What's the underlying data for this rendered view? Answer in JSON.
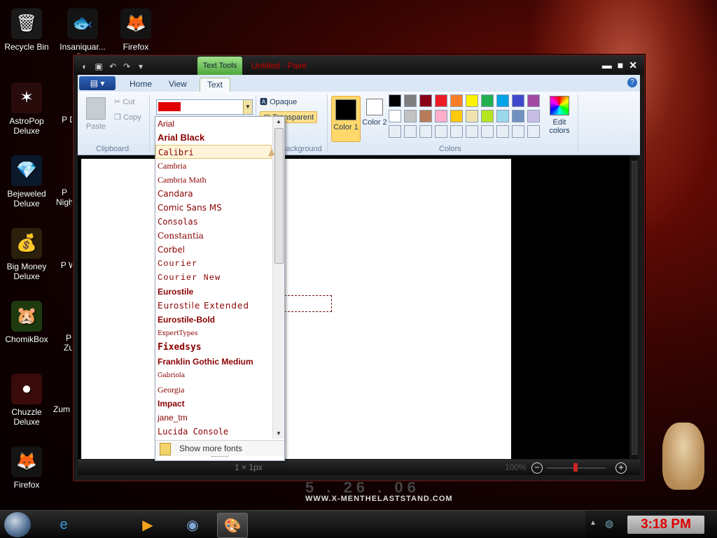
{
  "desktop": {
    "icons": [
      {
        "label": "Recycle Bin",
        "glyph": "🗑",
        "bg": "#1a1a1a"
      },
      {
        "label": "Insaniquar... Del",
        "glyph": "🐟",
        "bg": "#141414"
      },
      {
        "label": "Firefox",
        "glyph": "🦊",
        "bg": "#141414"
      },
      {
        "label": "AstroPop Deluxe",
        "glyph": "✶",
        "bg": "#2a0b0b"
      },
      {
        "label": "Bejeweled Deluxe",
        "glyph": "💎",
        "bg": "#0b1a2a"
      },
      {
        "label": "Big Money Deluxe",
        "glyph": "💰",
        "bg": "#2a200b"
      },
      {
        "label": "ChomikBox",
        "glyph": "🐹",
        "bg": "#1e3a0f"
      },
      {
        "label": "Chuzzle Deluxe",
        "glyph": "●",
        "bg": "#3a0b0b"
      },
      {
        "label": "Firefox",
        "glyph": "🦊",
        "bg": "#141414"
      }
    ],
    "partial_labels": [
      "P D",
      "P Nigh",
      "P W",
      "P Zu",
      "Zum"
    ],
    "wallpaper_url": "WWW.X-MENTHELASTSTAND.COM",
    "wallpaper_date": "5 . 26 . 06"
  },
  "paint": {
    "context_tab": "Text Tools",
    "doc_title": "Untitled - Paint",
    "window_buttons": [
      "▬",
      "■",
      "✕"
    ],
    "file_button": "▤ ▾",
    "tabs": [
      "Home",
      "View",
      "Text"
    ],
    "active_tab": "Text",
    "clipboard": {
      "paste": "Paste",
      "cut": "Cut",
      "copy": "Copy",
      "label": "Clipboard"
    },
    "background": {
      "opaque": "Opaque",
      "transparent": "Transparent",
      "label": "Background"
    },
    "colors": {
      "color1_label": "Color 1",
      "color1": "#000000",
      "color2_label": "Color 2",
      "color2": "#ffffff",
      "edit_label": "Edit colors",
      "group_label": "Colors",
      "palette": [
        "#000000",
        "#7f7f7f",
        "#880015",
        "#ed1c24",
        "#ff7f27",
        "#fff200",
        "#22b14c",
        "#00a2e8",
        "#3f48cc",
        "#a349a4",
        "#ffffff",
        "#c3c3c3",
        "#b97a57",
        "#ffaec9",
        "#ffc90e",
        "#efe4b0",
        "#b5e61d",
        "#99d9ea",
        "#7092be",
        "#c8bfe7",
        "#e8eef6",
        "#e8eef6",
        "#e8eef6",
        "#e8eef6",
        "#e8eef6",
        "#e8eef6",
        "#e8eef6",
        "#e8eef6",
        "#e8eef6",
        "#e8eef6"
      ]
    },
    "status": {
      "dimensions": "1 × 1px",
      "zoom": "100%"
    }
  },
  "font_dropdown": {
    "fonts": [
      {
        "name": "Arial",
        "family": "Liberation Sans, sans-serif",
        "weight": "normal",
        "color": "#8a0000"
      },
      {
        "name": "Arial Black",
        "family": "Liberation Sans, sans-serif",
        "weight": "900",
        "color": "#8a0000"
      },
      {
        "name": "Calibri",
        "family": "DejaVu Sans Mono, monospace",
        "weight": "normal",
        "color": "#8a0000"
      },
      {
        "name": "Cambria",
        "family": "Liberation Serif, serif",
        "weight": "normal",
        "color": "#8a0000"
      },
      {
        "name": "Cambria Math",
        "family": "Liberation Serif, serif",
        "weight": "normal",
        "color": "#8a0000"
      },
      {
        "name": "Candara",
        "family": "DejaVu Sans, sans-serif",
        "weight": "normal",
        "color": "#8a0000"
      },
      {
        "name": "Comic Sans MS",
        "family": "DejaVu Sans, sans-serif",
        "weight": "normal",
        "color": "#8a0000"
      },
      {
        "name": "Consolas",
        "family": "DejaVu Sans Mono, monospace",
        "weight": "normal",
        "color": "#8a0000"
      },
      {
        "name": "Constantia",
        "family": "DejaVu Serif, serif",
        "weight": "normal",
        "color": "#8a0000"
      },
      {
        "name": "Corbel",
        "family": "DejaVu Sans, sans-serif",
        "weight": "normal",
        "color": "#8a0000"
      },
      {
        "name": "Courier",
        "family": "Liberation Mono, monospace",
        "weight": "normal",
        "color": "#8a0000"
      },
      {
        "name": "Courier New",
        "family": "Liberation Mono, monospace",
        "weight": "normal",
        "color": "#8a0000"
      },
      {
        "name": "Eurostile",
        "family": "Liberation Sans, sans-serif",
        "weight": "bold",
        "color": "#8a0000"
      },
      {
        "name": "Eurostile Extended",
        "family": "DejaVu Sans, sans-serif",
        "weight": "normal",
        "color": "#8a0000"
      },
      {
        "name": "Eurostile-Bold",
        "family": "Liberation Sans, sans-serif",
        "weight": "bold",
        "color": "#8a0000"
      },
      {
        "name": "ExpertTypes",
        "family": "DejaVu Serif, serif",
        "weight": "normal",
        "color": "#8a0000"
      },
      {
        "name": "Fixedsys",
        "family": "DejaVu Sans Mono, monospace",
        "weight": "bold",
        "color": "#8a0000"
      },
      {
        "name": "Franklin Gothic Medium",
        "family": "Liberation Sans, sans-serif",
        "weight": "bold",
        "color": "#8a0000"
      },
      {
        "name": "Gabriola",
        "family": "DejaVu Serif, serif",
        "weight": "normal",
        "color": "#8a0000"
      },
      {
        "name": "Georgia",
        "family": "Liberation Serif, serif",
        "weight": "normal",
        "color": "#8a0000"
      },
      {
        "name": "Impact",
        "family": "Liberation Sans, sans-serif",
        "weight": "900",
        "color": "#8a0000"
      },
      {
        "name": "jane_tm",
        "family": "Liberation Sans, sans-serif",
        "weight": "normal",
        "color": "#8a0000"
      },
      {
        "name": "Lucida Console",
        "family": "DejaVu Sans Mono, monospace",
        "weight": "normal",
        "color": "#8a0000"
      }
    ],
    "hovered": "Calibri",
    "show_more": "Show more fonts"
  },
  "taskbar": {
    "clock": "3:18 PM",
    "apps": [
      {
        "name": "internet-explorer",
        "glyph": "e"
      },
      {
        "name": "media-player",
        "glyph": "▶"
      },
      {
        "name": "globe",
        "glyph": "◉"
      },
      {
        "name": "paint",
        "glyph": "🎨"
      }
    ]
  }
}
